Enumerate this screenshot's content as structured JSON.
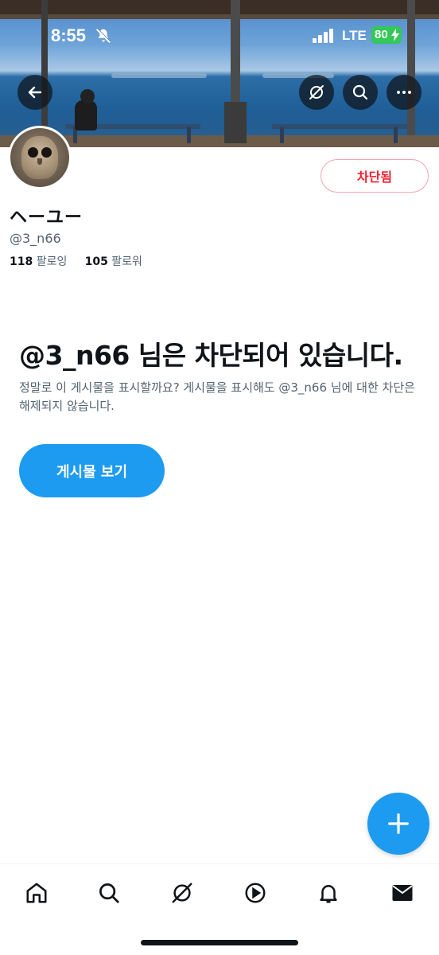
{
  "status_bar": {
    "time": "8:55",
    "network": "LTE",
    "battery": "80"
  },
  "profile": {
    "display_name": "ヘーユー",
    "handle": "@3_n66",
    "following_count": "118",
    "following_label": "팔로잉",
    "followers_count": "105",
    "followers_label": "팔로워",
    "blocked_button_label": "차단됨"
  },
  "block_notice": {
    "title_handle": "@3_n66",
    "title_suffix": " 님은 차단되어 있습니다.",
    "description": "정말로 이 게시물을 표시할까요? 게시물을 표시해도 @3_n66 님에 대한 차단은 해제되지 않습니다.",
    "view_posts_label": "게시물 보기"
  },
  "icons": {
    "back": "back-arrow-icon",
    "grok": "grok-icon",
    "search": "search-icon",
    "more": "more-icon",
    "compose": "plus-icon",
    "tabs": [
      "home-icon",
      "search-icon",
      "grok-icon",
      "video-icon",
      "notifications-icon",
      "messages-icon"
    ]
  },
  "colors": {
    "accent": "#1d9bf0",
    "blocked_red": "#f4212e",
    "battery_green": "#34c759"
  }
}
